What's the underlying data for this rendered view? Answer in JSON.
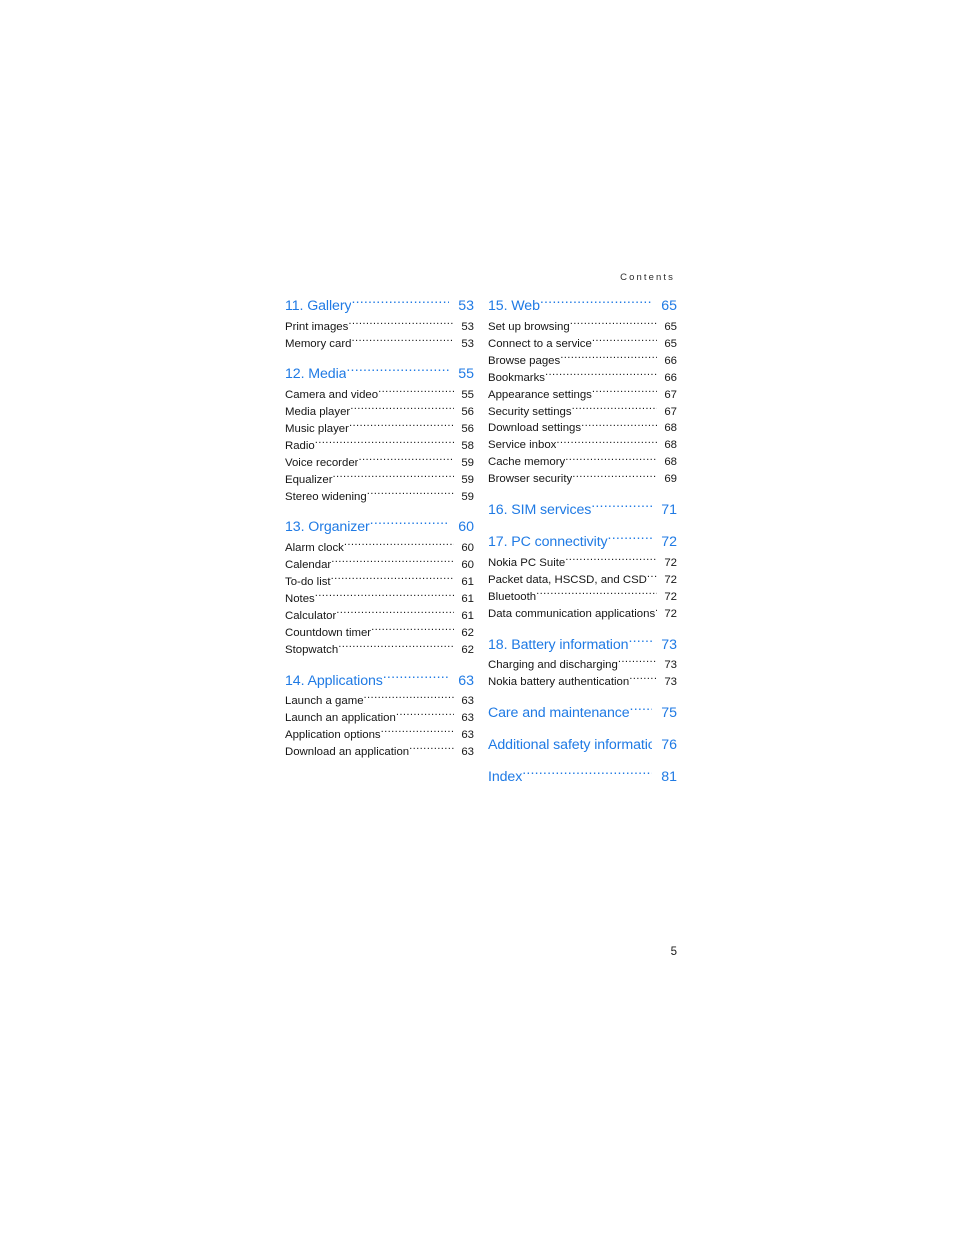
{
  "header": {
    "running_head": "Contents"
  },
  "folio": {
    "page_number": "5"
  },
  "colors": {
    "heading_blue": "#1f7ae4",
    "body_text": "#161616",
    "background": "#ffffff"
  },
  "toc": {
    "left_column": [
      {
        "chapter": {
          "title": "11. Gallery",
          "page": "53"
        },
        "entries": [
          {
            "title": "Print images",
            "page": "53"
          },
          {
            "title": "Memory card",
            "page": "53"
          }
        ]
      },
      {
        "chapter": {
          "title": "12. Media",
          "page": "55"
        },
        "entries": [
          {
            "title": "Camera and video",
            "page": "55"
          },
          {
            "title": "Media player",
            "page": "56"
          },
          {
            "title": "Music player",
            "page": "56"
          },
          {
            "title": "Radio",
            "page": "58"
          },
          {
            "title": "Voice recorder",
            "page": "59"
          },
          {
            "title": "Equalizer",
            "page": "59"
          },
          {
            "title": "Stereo widening",
            "page": "59"
          }
        ]
      },
      {
        "chapter": {
          "title": "13. Organizer",
          "page": "60"
        },
        "entries": [
          {
            "title": "Alarm clock",
            "page": "60"
          },
          {
            "title": "Calendar",
            "page": "60"
          },
          {
            "title": "To-do list",
            "page": "61"
          },
          {
            "title": "Notes",
            "page": "61"
          },
          {
            "title": "Calculator",
            "page": "61"
          },
          {
            "title": "Countdown timer",
            "page": "62"
          },
          {
            "title": "Stopwatch",
            "page": "62"
          }
        ]
      },
      {
        "chapter": {
          "title": "14. Applications",
          "page": "63"
        },
        "entries": [
          {
            "title": "Launch a game",
            "page": "63"
          },
          {
            "title": "Launch an application",
            "page": "63"
          },
          {
            "title": "Application options",
            "page": "63"
          },
          {
            "title": "Download an application",
            "page": "63"
          }
        ]
      }
    ],
    "right_column": [
      {
        "chapter": {
          "title": "15. Web",
          "page": "65"
        },
        "entries": [
          {
            "title": "Set up browsing",
            "page": "65"
          },
          {
            "title": "Connect to a service",
            "page": "65"
          },
          {
            "title": "Browse pages",
            "page": "66"
          },
          {
            "title": "Bookmarks",
            "page": "66"
          },
          {
            "title": "Appearance settings",
            "page": "67"
          },
          {
            "title": "Security settings",
            "page": "67"
          },
          {
            "title": "Download settings",
            "page": "68"
          },
          {
            "title": "Service inbox",
            "page": "68"
          },
          {
            "title": "Cache memory",
            "page": "68"
          },
          {
            "title": "Browser security",
            "page": "69"
          }
        ]
      },
      {
        "chapter": {
          "title": "16. SIM services",
          "page": "71"
        },
        "entries": []
      },
      {
        "chapter": {
          "title": "17. PC connectivity",
          "page": "72"
        },
        "entries": [
          {
            "title": "Nokia PC Suite",
            "page": "72"
          },
          {
            "title": "Packet data, HSCSD, and CSD",
            "page": "72"
          },
          {
            "title": "Bluetooth",
            "page": "72"
          },
          {
            "title": "Data communication applications",
            "page": "72"
          }
        ]
      },
      {
        "chapter": {
          "title": "18. Battery information",
          "page": "73"
        },
        "entries": [
          {
            "title": "Charging and discharging",
            "page": "73"
          },
          {
            "title": "Nokia battery authentication",
            "page": "73"
          }
        ]
      },
      {
        "chapter": {
          "title": "Care and maintenance",
          "page": "75"
        },
        "entries": []
      },
      {
        "chapter": {
          "title": "Additional safety information",
          "page": "76",
          "no_leader": true
        },
        "entries": []
      },
      {
        "chapter": {
          "title": "Index",
          "page": "81"
        },
        "entries": []
      }
    ]
  }
}
